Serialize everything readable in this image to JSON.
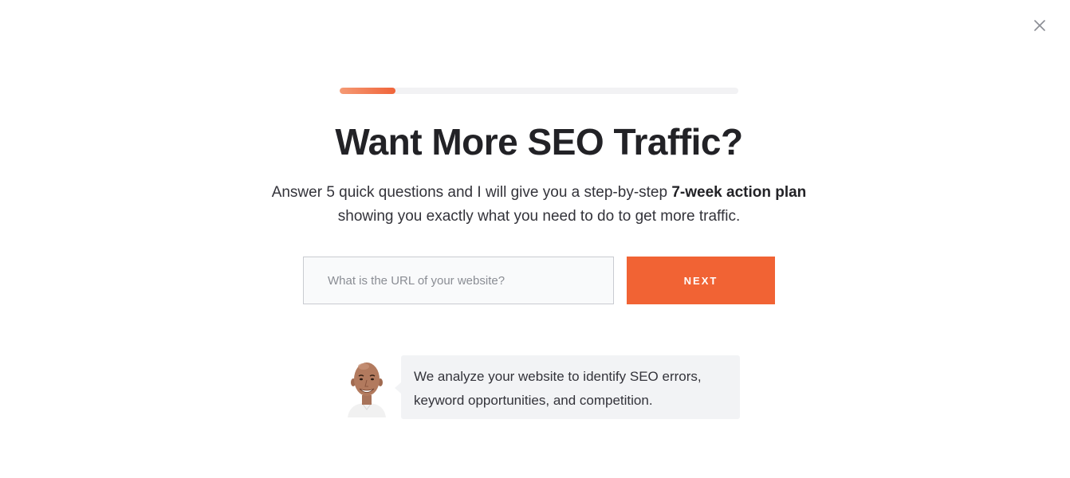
{
  "close": {
    "icon": "close-icon"
  },
  "progress": {
    "value_percent": 14,
    "accent": "#f16334"
  },
  "heading": {
    "title": "Want More SEO Traffic?"
  },
  "subtitle": {
    "line1_prefix": "Answer 5 quick questions and I will give you a step-by-step ",
    "line1_bold": "7-week action plan",
    "line2": "showing you exactly what you need to do to get more traffic."
  },
  "form": {
    "url_placeholder": "What is the URL of your website?",
    "url_value": "",
    "next_label": "NEXT",
    "button_color": "#f16334"
  },
  "assistant": {
    "avatar_icon": "avatar-portrait",
    "message_line1": "We analyze your website to identify SEO errors,",
    "message_line2": "keyword opportunities, and competition."
  }
}
